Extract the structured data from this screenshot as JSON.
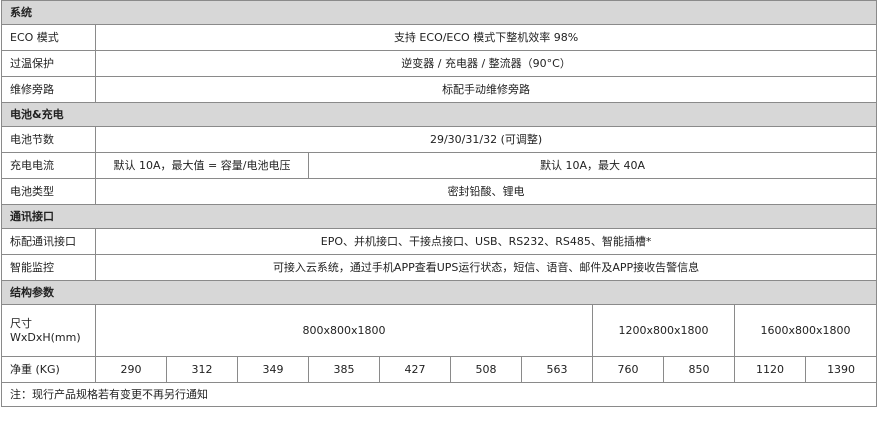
{
  "sections": {
    "system": "系统",
    "battery": "电池&充电",
    "comm": "通讯接口",
    "structure": "结构参数"
  },
  "rows": {
    "eco": {
      "label": "ECO 模式",
      "value": "支持 ECO/ECO 模式下整机效率 98%"
    },
    "overtemp": {
      "label": "过温保护",
      "value": "逆变器 / 充电器 / 整流器（90°C）"
    },
    "bypass": {
      "label": "维修旁路",
      "value": "标配手动维修旁路"
    },
    "cells": {
      "label": "电池节数",
      "value": "29/30/31/32 (可调整)"
    },
    "charge": {
      "label": "充电电流",
      "value_a": "默认 10A，最大值 = 容量/电池电压",
      "value_b": "默认 10A，最大 40A"
    },
    "battery_type": {
      "label": "电池类型",
      "value": "密封铅酸、锂电"
    },
    "std_ports": {
      "label": "标配通讯接口",
      "value": "EPO、并机接口、干接点接口、USB、RS232、RS485、智能插槽*"
    },
    "monitor": {
      "label": "智能监控",
      "value": "可接入云系统，通过手机APP查看UPS运行状态，短信、语音、邮件及APP接收告警信息"
    }
  },
  "dimensions": {
    "label_line1": "尺寸",
    "label_line2": "WxDxH(mm)",
    "values": [
      "800x800x1800",
      "1200x800x1800",
      "1600x800x1800"
    ]
  },
  "weight": {
    "label": "净重 (KG)",
    "values": [
      "290",
      "312",
      "349",
      "385",
      "427",
      "508",
      "563",
      "760",
      "850",
      "1120",
      "1390"
    ]
  },
  "note": "注：现行产品规格若有变更不再另行通知"
}
